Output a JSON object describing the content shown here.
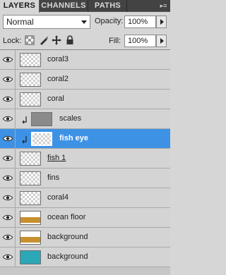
{
  "tabs": [
    {
      "label": "LAYERS"
    },
    {
      "label": "CHANNELS"
    },
    {
      "label": "PATHS"
    }
  ],
  "blend_mode": {
    "value": "Normal"
  },
  "opacity": {
    "label": "Opacity:",
    "value": "100%"
  },
  "lock": {
    "label": "Lock:"
  },
  "fill": {
    "label": "Fill:",
    "value": "100%"
  },
  "layers": [
    {
      "name": "coral3"
    },
    {
      "name": "coral2"
    },
    {
      "name": "coral"
    },
    {
      "name": "scales"
    },
    {
      "name": "fish eye"
    },
    {
      "name": "fish 1"
    },
    {
      "name": "fins"
    },
    {
      "name": "coral4"
    },
    {
      "name": "ocean floor"
    },
    {
      "name": "background"
    },
    {
      "name": "background"
    }
  ],
  "colors": {
    "selection": "#3d92e6",
    "tab_bar": "#434343",
    "ocean_floor": "#c8902e",
    "water": "#2ba7b8"
  }
}
